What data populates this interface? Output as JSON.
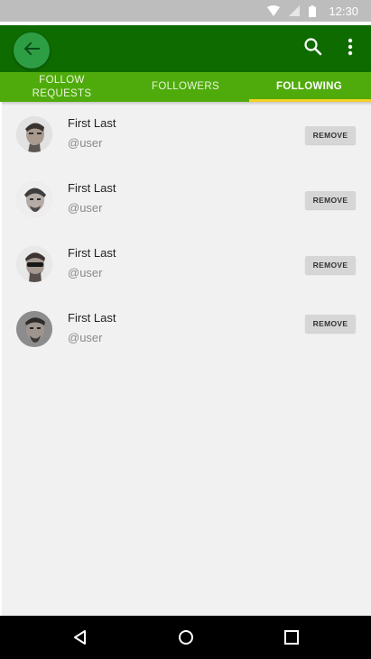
{
  "status_bar": {
    "time": "12:30",
    "icons": [
      "wifi-icon",
      "signal-icon",
      "battery-icon"
    ]
  },
  "app_bar": {
    "back_icon": "arrow-left-icon",
    "search_icon": "search-icon",
    "more_icon": "more-vertical-icon",
    "color": "#0e6b00"
  },
  "tabs": [
    {
      "label_line1": "FOLLOW",
      "label_line2": "REQUESTS",
      "active": false
    },
    {
      "label": "FOLLOWERS",
      "active": false
    },
    {
      "label": "FOLLOWING",
      "active": true
    }
  ],
  "tab_colors": {
    "bar": "#4fab0c",
    "indicator": "#f4d125"
  },
  "list": [
    {
      "name": "First Last",
      "handle": "@user",
      "action": "REMOVE"
    },
    {
      "name": "First Last",
      "handle": "@user",
      "action": "REMOVE"
    },
    {
      "name": "First Last",
      "handle": "@user",
      "action": "REMOVE"
    },
    {
      "name": "First Last",
      "handle": "@user",
      "action": "REMOVE"
    }
  ],
  "nav_bar": {
    "icons": [
      "back-triangle-icon",
      "home-circle-icon",
      "recents-square-icon"
    ]
  }
}
